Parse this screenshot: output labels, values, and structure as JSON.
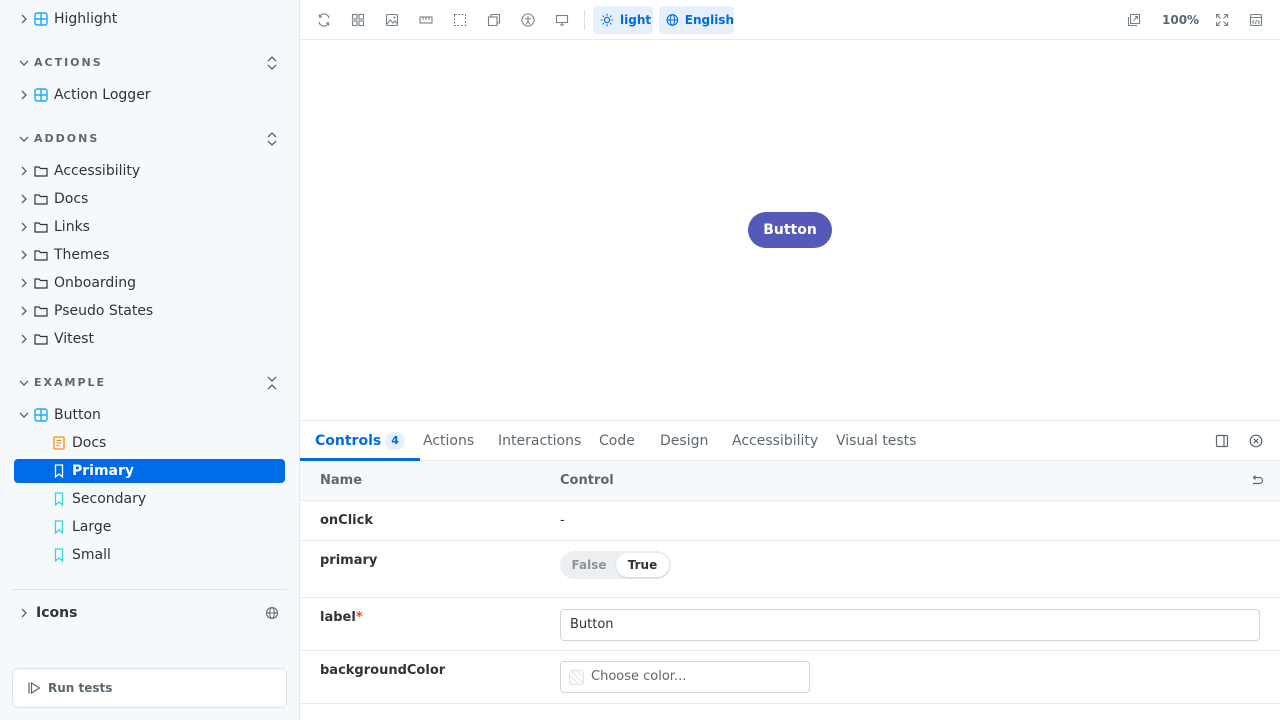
{
  "sidebar": {
    "top_item": {
      "label": "Highlight"
    },
    "sections": {
      "actions": {
        "title": "ACTIONS",
        "items": [
          {
            "label": "Action Logger"
          }
        ]
      },
      "addons": {
        "title": "ADDONS",
        "items": [
          {
            "label": "Accessibility"
          },
          {
            "label": "Docs"
          },
          {
            "label": "Links"
          },
          {
            "label": "Themes"
          },
          {
            "label": "Onboarding"
          },
          {
            "label": "Pseudo States"
          },
          {
            "label": "Vitest"
          }
        ]
      },
      "example": {
        "title": "EXAMPLE",
        "component": {
          "label": "Button"
        },
        "stories": [
          {
            "label": "Docs",
            "kind": "docs"
          },
          {
            "label": "Primary",
            "kind": "story",
            "selected": true
          },
          {
            "label": "Secondary",
            "kind": "story"
          },
          {
            "label": "Large",
            "kind": "story"
          },
          {
            "label": "Small",
            "kind": "story"
          }
        ]
      }
    },
    "icons_label": "Icons",
    "run_tests_label": "Run tests"
  },
  "toolbar": {
    "icons": [
      "reload-icon",
      "grid-icon",
      "background-icon",
      "measure-icon",
      "outline-icon",
      "pseudo-states-icon",
      "accessibility-icon",
      "viewport-icon"
    ],
    "theme_label": "light",
    "locale_label": "English",
    "zoom": "100%",
    "right_icons": [
      "open-new-tab-icon",
      "fullscreen-icon",
      "share-icon"
    ]
  },
  "preview": {
    "button_label": "Button",
    "button_color": "#555ab9"
  },
  "panel": {
    "tabs": [
      {
        "label": "Controls",
        "count": "4",
        "active": true
      },
      {
        "label": "Actions"
      },
      {
        "label": "Interactions"
      },
      {
        "label": "Code"
      },
      {
        "label": "Design"
      },
      {
        "label": "Accessibility"
      },
      {
        "label": "Visual tests"
      }
    ],
    "headers": {
      "name": "Name",
      "control": "Control"
    },
    "args": {
      "onClick": {
        "name": "onClick",
        "value": "-"
      },
      "primary": {
        "name": "primary",
        "off_label": "False",
        "on_label": "True",
        "value": true
      },
      "label": {
        "name": "label",
        "required_mark": "*",
        "value": "Button"
      },
      "backgroundColor": {
        "name": "backgroundColor",
        "placeholder": "Choose color..."
      }
    }
  },
  "colors": {
    "accent": "#006be6",
    "sidebar_bg": "#f6f9fc",
    "primary_button": "#555ab9"
  }
}
